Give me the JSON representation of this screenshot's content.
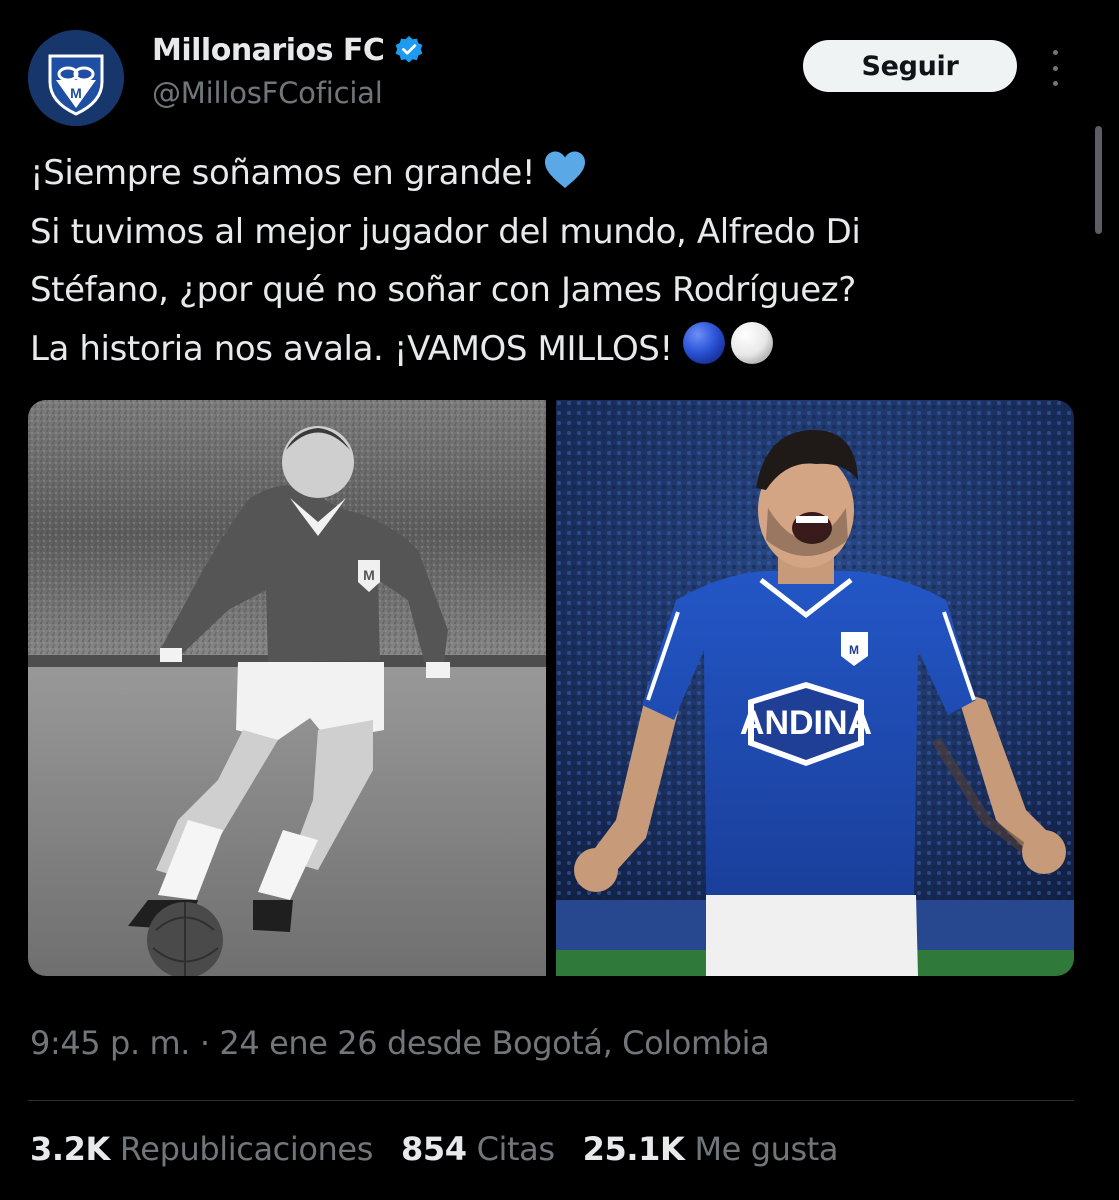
{
  "author": {
    "name": "Millonarios FC",
    "handle": "@MillosFCoficial",
    "avatar_label": "M",
    "verified": true
  },
  "actions": {
    "follow_label": "Seguir",
    "more_icon": "more-vertical-icon"
  },
  "tweet": {
    "lines": [
      "¡Siempre soñamos en grande!",
      "Si tuvimos al mejor jugador del mundo, Alfredo Di",
      "Stéfano, ¿por qué no soñar con James Rodríguez?",
      "La historia nos avala. ¡VAMOS MILLOS!"
    ],
    "emojis": [
      "blue-heart-icon",
      "blue-circle-icon",
      "white-circle-icon"
    ]
  },
  "media": {
    "left_shirt_badge": "M",
    "right_sponsor": "ANDINA",
    "right_shirt_badge": "M"
  },
  "meta": {
    "time": "9:45 p. m.",
    "separator": "·",
    "date": "24 ene 26",
    "location": "desde Bogotá, Colombia"
  },
  "stats": [
    {
      "value": "3.2K",
      "label": "Republicaciones"
    },
    {
      "value": "854",
      "label": "Citas"
    },
    {
      "value": "25.1K",
      "label": "Me gusta"
    }
  ],
  "colors": {
    "background": "#000000",
    "text_primary": "#e7e9ea",
    "text_secondary": "#71767b",
    "verified_blue": "#1d9bf0",
    "club_blue": "#1e4fa8"
  }
}
